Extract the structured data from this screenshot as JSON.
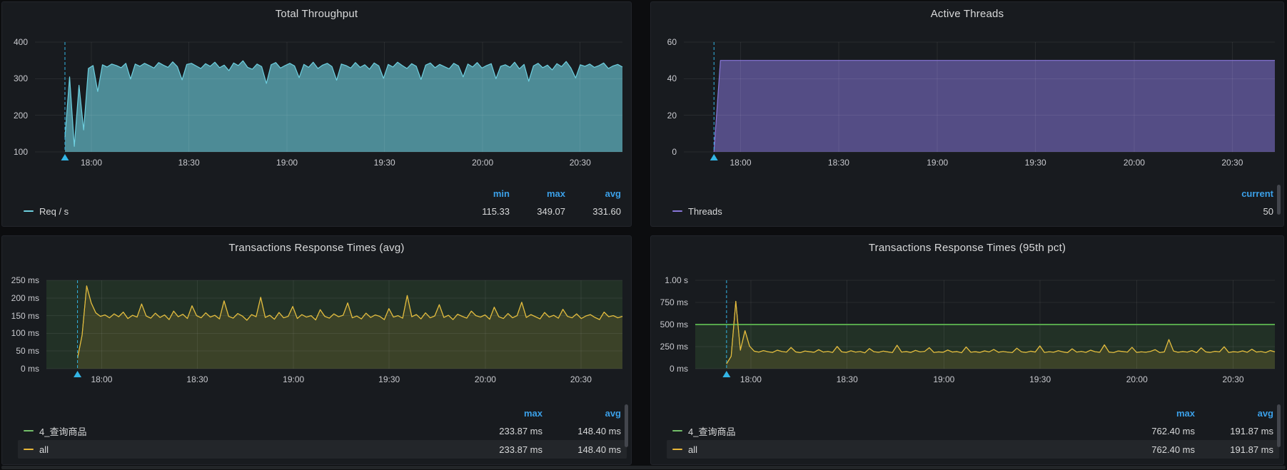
{
  "colors": {
    "page_bg": "#0c0d0f",
    "panel_bg": "#181b1f",
    "title_text": "#d8d9da",
    "axis_text": "#c8c9ce",
    "legend_header_blue": "#3ba0e8",
    "teal_series": "#6ed0e0",
    "purple_series": "#8877d9",
    "yellow_series": "#eab839",
    "green_series": "#73bf69",
    "threshold_green": "#56a64b",
    "annotation_cyan": "#33b5e5"
  },
  "panels": [
    {
      "title": "Total Throughput",
      "scrollbar": false,
      "chart_data": {
        "type": "area",
        "title": "Total Throughput",
        "ylabel": "",
        "ylim": [
          100,
          400
        ],
        "grid": true,
        "legend_position": "bottom",
        "yticks": [
          {
            "value": 400,
            "label": "400"
          },
          {
            "value": 300,
            "label": "300"
          },
          {
            "value": 200,
            "label": "200"
          },
          {
            "value": 100,
            "label": "100"
          }
        ],
        "xticks": [
          {
            "frac": 0.096,
            "label": "18:00"
          },
          {
            "frac": 0.262,
            "label": "18:30"
          },
          {
            "frac": 0.429,
            "label": "19:00"
          },
          {
            "frac": 0.595,
            "label": "19:30"
          },
          {
            "frac": 0.762,
            "label": "20:00"
          },
          {
            "frac": 0.928,
            "label": "20:30"
          }
        ],
        "annotation": {
          "frac": 0.051,
          "color": "#33b5e5"
        },
        "series": [
          {
            "name": "Req / s",
            "line": "#6ed0e0",
            "fill": "rgba(110,208,224,0.62)",
            "start_frac": 0.051,
            "points": [
              140,
              305,
              115,
              282,
              160,
              328,
              336,
              265,
              338,
              332,
              340,
              336,
              330,
              342,
              299,
              340,
              334,
              342,
              336,
              329,
              344,
              337,
              331,
              346,
              333,
              297,
              339,
              342,
              335,
              328,
              341,
              334,
              345,
              330,
              337,
              322,
              343,
              336,
              349,
              331,
              326,
              340,
              333,
              287,
              338,
              344,
              329,
              336,
              342,
              335,
              303,
              339,
              331,
              345,
              328,
              337,
              342,
              333,
              296,
              340,
              336,
              329,
              344,
              331,
              338,
              326,
              343,
              335,
              301,
              339,
              332,
              345,
              336,
              328,
              341,
              334,
              298,
              337,
              343,
              330,
              339,
              333,
              327,
              342,
              335,
              305,
              340,
              332,
              344,
              329,
              336,
              341,
              300,
              334,
              338,
              331,
              345,
              327,
              339,
              293,
              335,
              342,
              330,
              337,
              324,
              341,
              333,
              347,
              329,
              302,
              338,
              334,
              340,
              331,
              336,
              343,
              328,
              335,
              339,
              332
            ]
          }
        ],
        "stats": {
          "min": 115.33,
          "max": 349.07,
          "avg": 331.6
        }
      },
      "legend": {
        "columns": [
          "min",
          "max",
          "avg"
        ],
        "rows": [
          {
            "label": "Req / s",
            "color": "#6ed0e0",
            "values": [
              "115.33",
              "349.07",
              "331.60"
            ],
            "highlight": false
          }
        ]
      }
    },
    {
      "title": "Active Threads",
      "scrollbar": true,
      "chart_data": {
        "type": "area",
        "title": "Active Threads",
        "ylim": [
          0,
          60
        ],
        "grid": true,
        "legend_position": "bottom",
        "yticks": [
          {
            "value": 60,
            "label": "60"
          },
          {
            "value": 40,
            "label": "40"
          },
          {
            "value": 20,
            "label": "20"
          },
          {
            "value": 0,
            "label": "0"
          }
        ],
        "xticks": [
          {
            "frac": 0.096,
            "label": "18:00"
          },
          {
            "frac": 0.262,
            "label": "18:30"
          },
          {
            "frac": 0.429,
            "label": "19:00"
          },
          {
            "frac": 0.595,
            "label": "19:30"
          },
          {
            "frac": 0.762,
            "label": "20:00"
          },
          {
            "frac": 0.928,
            "label": "20:30"
          }
        ],
        "annotation": {
          "frac": 0.051,
          "color": "#33b5e5"
        },
        "series": [
          {
            "name": "Threads",
            "line": "#8877d9",
            "fill": "rgba(135,119,217,0.55)",
            "xy": [
              [
                0.051,
                0
              ],
              [
                0.062,
                50
              ],
              [
                1.0,
                50
              ]
            ]
          }
        ],
        "stats": {
          "current": 50
        }
      },
      "legend": {
        "columns": [
          "current"
        ],
        "rows": [
          {
            "label": "Threads",
            "color": "#8877d9",
            "values": [
              "50"
            ],
            "highlight": false
          }
        ]
      }
    },
    {
      "title": "Transactions Response Times (avg)",
      "scrollbar": true,
      "chart_data": {
        "type": "line",
        "title": "Transactions Response Times (avg)",
        "unit": "ms",
        "ylim": [
          0,
          250
        ],
        "grid": true,
        "legend_position": "bottom",
        "yticks": [
          {
            "value": 250,
            "label": "250 ms"
          },
          {
            "value": 200,
            "label": "200 ms"
          },
          {
            "value": 150,
            "label": "150 ms"
          },
          {
            "value": 100,
            "label": "100 ms"
          },
          {
            "value": 50,
            "label": "50 ms"
          },
          {
            "value": 0,
            "label": "0 ms"
          }
        ],
        "xticks": [
          {
            "frac": 0.096,
            "label": "18:00"
          },
          {
            "frac": 0.262,
            "label": "18:30"
          },
          {
            "frac": 0.429,
            "label": "19:00"
          },
          {
            "frac": 0.595,
            "label": "19:30"
          },
          {
            "frac": 0.762,
            "label": "20:00"
          },
          {
            "frac": 0.928,
            "label": "20:30"
          }
        ],
        "annotation": {
          "frac": 0.054,
          "color": "#33b5e5"
        },
        "threshold": {
          "value": 500,
          "line_color": "#56a64b",
          "region_color": "rgba(86,166,75,0.16)"
        },
        "series": [
          {
            "name": "4_查询商品",
            "line": "#73bf69",
            "points_same_as": "all"
          },
          {
            "name": "all",
            "line": "#eab839",
            "fill": "rgba(234,184,57,0.13)",
            "start_frac": 0.054,
            "points": [
              30,
              95,
              234,
              186,
              158,
              148,
              152,
              144,
              155,
              147,
              160,
              142,
              151,
              146,
              183,
              149,
              143,
              157,
              145,
              152,
              139,
              163,
              147,
              154,
              142,
              178,
              150,
              144,
              158,
              146,
              151,
              141,
              192,
              148,
              143,
              156,
              149,
              137,
              153,
              147,
              202,
              145,
              151,
              140,
              159,
              144,
              148,
              176,
              142,
              153,
              146,
              150,
              138,
              167,
              148,
              143,
              155,
              147,
              151,
              186,
              144,
              149,
              141,
              157,
              145,
              152,
              148,
              139,
              170,
              146,
              150,
              143,
              207,
              147,
              153,
              141,
              158,
              144,
              149,
              181,
              145,
              151,
              139,
              154,
              148,
              143,
              163,
              150,
              146,
              152,
              140,
              174,
              147,
              142,
              156,
              144,
              150,
              188,
              145,
              153,
              147,
              141,
              159,
              146,
              151,
              143,
              168,
              148,
              144,
              155,
              142,
              149,
              153,
              145,
              139,
              160,
              147,
              150,
              144,
              148
            ]
          }
        ],
        "stats": {
          "max": "233.87 ms",
          "avg": "148.40 ms"
        }
      },
      "legend": {
        "columns": [
          "max",
          "avg"
        ],
        "rows": [
          {
            "label": "4_查询商品",
            "color": "#73bf69",
            "values": [
              "233.87 ms",
              "148.40 ms"
            ],
            "highlight": false
          },
          {
            "label": "all",
            "color": "#eab839",
            "values": [
              "233.87 ms",
              "148.40 ms"
            ],
            "highlight": true
          }
        ]
      }
    },
    {
      "title": "Transactions Response Times (95th pct)",
      "scrollbar": true,
      "chart_data": {
        "type": "line",
        "title": "Transactions Response Times (95th pct)",
        "unit": "ms",
        "ylim": [
          0,
          1000
        ],
        "grid": true,
        "legend_position": "bottom",
        "yticks": [
          {
            "value": 1000,
            "label": "1.00 s"
          },
          {
            "value": 750,
            "label": "750 ms"
          },
          {
            "value": 500,
            "label": "500 ms"
          },
          {
            "value": 250,
            "label": "250 ms"
          },
          {
            "value": 0,
            "label": "0 ms"
          }
        ],
        "xticks": [
          {
            "frac": 0.096,
            "label": "18:00"
          },
          {
            "frac": 0.262,
            "label": "18:30"
          },
          {
            "frac": 0.429,
            "label": "19:00"
          },
          {
            "frac": 0.595,
            "label": "19:30"
          },
          {
            "frac": 0.762,
            "label": "20:00"
          },
          {
            "frac": 0.928,
            "label": "20:30"
          }
        ],
        "annotation": {
          "frac": 0.054,
          "color": "#33b5e5"
        },
        "threshold": {
          "value": 500,
          "line_color": "#56a64b",
          "region_color": "rgba(86,166,75,0.16)"
        },
        "series": [
          {
            "name": "4_查询商品",
            "line": "#73bf69",
            "points_same_as": "all"
          },
          {
            "name": "all",
            "line": "#eab839",
            "fill": "rgba(234,184,57,0.13)",
            "start_frac": 0.054,
            "points": [
              55,
              140,
              762,
              210,
              430,
              255,
              198,
              188,
              205,
              192,
              185,
              210,
              195,
              188,
              240,
              190,
              182,
              200,
              193,
              186,
              215,
              189,
              196,
              184,
              252,
              191,
              185,
              203,
              188,
              195,
              180,
              228,
              192,
              186,
              199,
              190,
              183,
              265,
              188,
              194,
              185,
              207,
              191,
              196,
              238,
              184,
              190,
              186,
              211,
              189,
              194,
              181,
              246,
              187,
              193,
              185,
              202,
              190,
              218,
              186,
              195,
              188,
              183,
              232,
              191,
              185,
              198,
              189,
              258,
              184,
              192,
              187,
              204,
              190,
              182,
              225,
              188,
              196,
              185,
              210,
              192,
              186,
              270,
              189,
              183,
              201,
              194,
              188,
              242,
              185,
              191,
              187,
              196,
              215,
              183,
              190,
              330,
              200,
              186,
              194,
              188,
              205,
              182,
              236,
              190,
              185,
              197,
              191,
              248,
              184,
              193,
              188,
              202,
              186,
              220,
              189,
              195,
              183,
              206,
              191
            ]
          }
        ],
        "stats": {
          "max": "762.40 ms",
          "avg": "191.87 ms"
        }
      },
      "legend": {
        "columns": [
          "max",
          "avg"
        ],
        "rows": [
          {
            "label": "4_查询商品",
            "color": "#73bf69",
            "values": [
              "762.40 ms",
              "191.87 ms"
            ],
            "highlight": false
          },
          {
            "label": "all",
            "color": "#eab839",
            "values": [
              "762.40 ms",
              "191.87 ms"
            ],
            "highlight": true
          }
        ]
      }
    }
  ]
}
